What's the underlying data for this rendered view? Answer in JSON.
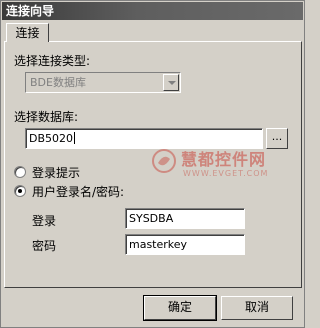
{
  "window": {
    "title": "连接向导"
  },
  "tabs": [
    {
      "label": "连接"
    }
  ],
  "connection_type": {
    "label": "选择连接类型:",
    "selected": "BDE数据库"
  },
  "database": {
    "label": "选择数据库:",
    "value": "DB5020",
    "browse_label": "..."
  },
  "login": {
    "prompt_option": "登录提示",
    "userpass_option": "用户登录名/密码:",
    "selected_option": "userpass",
    "username_label": "登录",
    "username_value": "SYSDBA",
    "password_label": "密码",
    "password_value": "masterkey"
  },
  "buttons": {
    "ok": "确定",
    "cancel": "取消"
  },
  "watermark": {
    "text": "慧都控件网",
    "url": "WWW.EVGET.COM"
  }
}
